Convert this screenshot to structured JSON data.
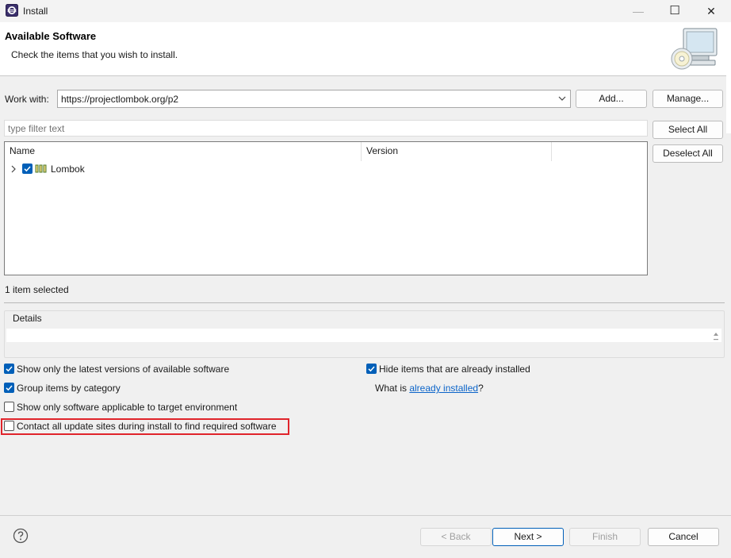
{
  "window": {
    "title": "Install",
    "minimize_glyph": "—",
    "maximize_glyph": "☐",
    "close_glyph": "✕"
  },
  "banner": {
    "title": "Available Software",
    "description": "Check the items that you wish to install."
  },
  "work_with": {
    "label": "Work with:",
    "value": "https://projectlombok.org/p2",
    "add_label": "Add...",
    "manage_label": "Manage..."
  },
  "filter": {
    "placeholder": "type filter text"
  },
  "buttons_side": {
    "select_all": "Select All",
    "deselect_all": "Deselect All"
  },
  "tree": {
    "columns": [
      "Name",
      "Version"
    ],
    "items": [
      {
        "label": "Lombok",
        "checked": true,
        "version": ""
      }
    ]
  },
  "status": {
    "selected_count": "1 item selected"
  },
  "details": {
    "title": "Details"
  },
  "options": {
    "latest_versions": {
      "label": "Show only the latest versions of available software",
      "checked": true
    },
    "group_by_category": {
      "label": "Group items by category",
      "checked": true
    },
    "applicable_only": {
      "label": "Show only software applicable to target environment",
      "checked": false
    },
    "contact_update_sites": {
      "label": "Contact all update sites during install to find required software",
      "checked": false
    },
    "hide_installed": {
      "label": "Hide items that are already installed",
      "checked": true
    },
    "what_is_prefix": "What is ",
    "what_is_link": "already installed",
    "what_is_suffix": "?"
  },
  "footer": {
    "back_label": "< Back",
    "next_label": "Next >",
    "finish_label": "Finish",
    "cancel_label": "Cancel"
  },
  "colors": {
    "accent": "#005fb8",
    "highlight": "#e0242b",
    "link": "#0b64c9"
  }
}
